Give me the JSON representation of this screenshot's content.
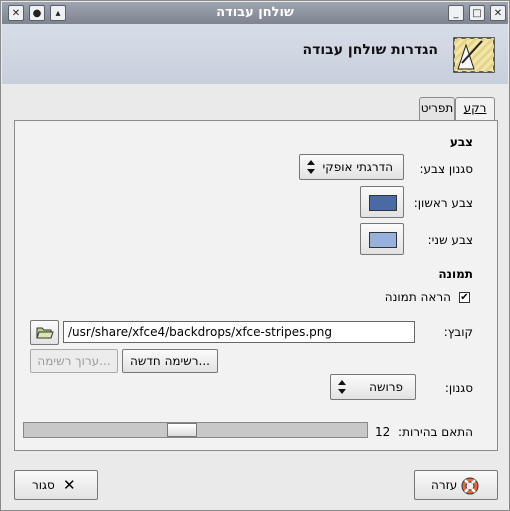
{
  "window": {
    "title": "שולחן עבודה",
    "header_title": "הגדרות שולחן עבודה"
  },
  "tabs": [
    {
      "label": "רקע",
      "active": true
    },
    {
      "label": "תפריט",
      "active": false
    }
  ],
  "color_section": {
    "heading": "צבע",
    "style_label": "סגנון צבע:",
    "style_value": "הדרגתי אופקי",
    "first_color_label": "צבע ראשון:",
    "first_color": "#4a6aa6",
    "second_color_label": "צבע שני:",
    "second_color": "#98b0dc"
  },
  "image_section": {
    "heading": "תמונה",
    "show_image_label": "הראה תמונה",
    "show_image_checked": true,
    "file_label": "קובץ:",
    "file_value": "/usr/share/xfce4/backdrops/xfce-stripes.png",
    "new_list_button": "רשימה חדשה...",
    "edit_list_button": "ערוך רשימה...",
    "style_label": "סגנון:",
    "style_value": "פרושה",
    "brightness_label": "התאם בהירות:",
    "brightness_value": "12"
  },
  "footer": {
    "help_button": "עזרה",
    "close_button": "סגור"
  }
}
